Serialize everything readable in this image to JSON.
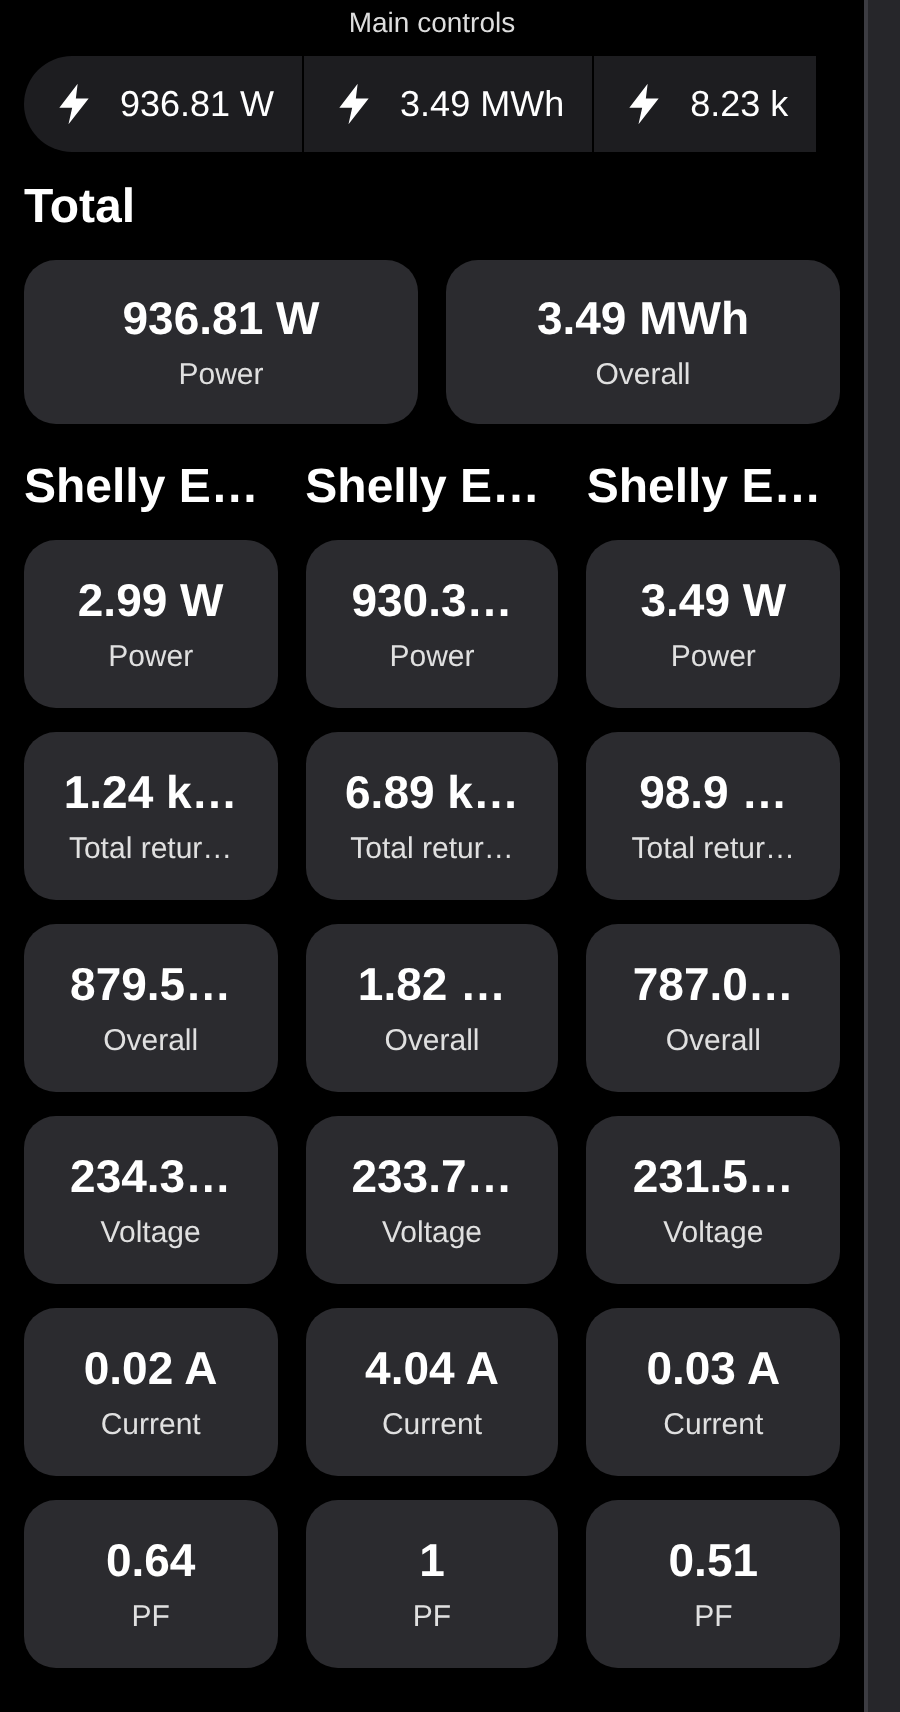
{
  "header": {
    "title": "Main controls"
  },
  "chips": [
    {
      "value": "936.81 W"
    },
    {
      "value": "3.49 MWh"
    },
    {
      "value": "8.23 k"
    }
  ],
  "total": {
    "title": "Total",
    "cards": [
      {
        "value": "936.81 W",
        "label": "Power"
      },
      {
        "value": "3.49 MWh",
        "label": "Overall"
      }
    ]
  },
  "devices": [
    {
      "name": "Shelly E…",
      "cards": [
        {
          "value": "2.99 W",
          "label": "Power"
        },
        {
          "value": "1.24 k…",
          "label": "Total retur…"
        },
        {
          "value": "879.5…",
          "label": "Overall"
        },
        {
          "value": "234.3…",
          "label": "Voltage"
        },
        {
          "value": "0.02 A",
          "label": "Current"
        },
        {
          "value": "0.64",
          "label": "PF"
        }
      ]
    },
    {
      "name": "Shelly E…",
      "cards": [
        {
          "value": "930.3…",
          "label": "Power"
        },
        {
          "value": "6.89 k…",
          "label": "Total retur…"
        },
        {
          "value": "1.82 …",
          "label": "Overall"
        },
        {
          "value": "233.7…",
          "label": "Voltage"
        },
        {
          "value": "4.04 A",
          "label": "Current"
        },
        {
          "value": "1",
          "label": "PF"
        }
      ]
    },
    {
      "name": "Shelly E…",
      "cards": [
        {
          "value": "3.49 W",
          "label": "Power"
        },
        {
          "value": "98.9 …",
          "label": "Total retur…"
        },
        {
          "value": "787.0…",
          "label": "Overall"
        },
        {
          "value": "231.5…",
          "label": "Voltage"
        },
        {
          "value": "0.03 A",
          "label": "Current"
        },
        {
          "value": "0.51",
          "label": "PF"
        }
      ]
    }
  ]
}
